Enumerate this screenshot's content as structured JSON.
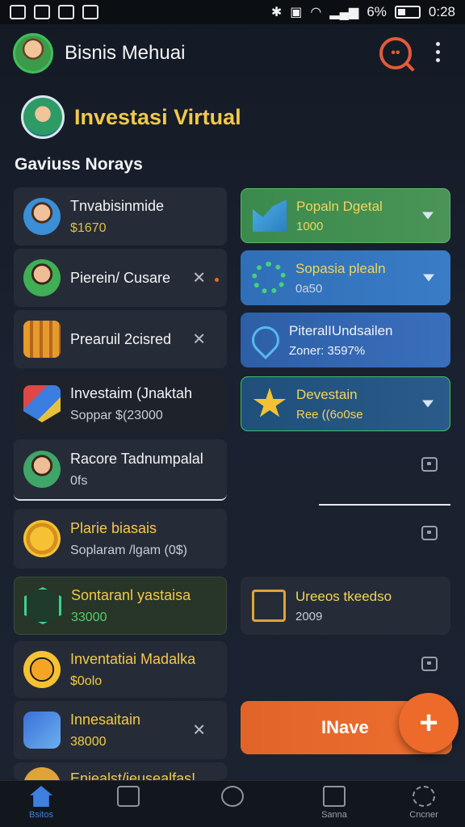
{
  "status_bar": {
    "battery_text": "6%",
    "time": "0:28"
  },
  "header": {
    "title": "Bisnis Mehuai"
  },
  "banner": {
    "title": "Investasi Virtual"
  },
  "section": {
    "title": "Gaviuss Norays"
  },
  "left_cards": [
    {
      "name": "Tnvabisinmide",
      "sub": "$1670"
    },
    {
      "name": "Pierein/ Cusare",
      "sub": ""
    },
    {
      "name": "Prearuil 2cisred",
      "sub": ""
    },
    {
      "name": "Investaim (Jnaktah",
      "sub": "Soppar $(23000"
    },
    {
      "name": "Racore Tadnumpalal",
      "sub": "0fs"
    },
    {
      "name": "Plarie biasais",
      "sub": "Soplaram /lgam (0$)"
    },
    {
      "name": "Sontaranl yastaisa",
      "sub": "33000"
    },
    {
      "name": "Inventatiai Madalka",
      "sub": "$0olo"
    },
    {
      "name": "Innesaitain",
      "sub": "38000"
    },
    {
      "name": "Eniealst/jeusealfas!",
      "sub": ""
    }
  ],
  "right_cards": [
    {
      "name": "Popaln Dgetal",
      "sub": "1000"
    },
    {
      "name": "Sopasia plealn",
      "sub": "0a50"
    },
    {
      "name": "PiteralIUndsailen",
      "sub": "Zoner: 3597%"
    },
    {
      "name": "Devestain",
      "sub": "Ree ((6o0se"
    },
    {
      "name": "Ureeos tkeedso",
      "sub": "2009"
    }
  ],
  "cta": {
    "label": "INave"
  },
  "fab": {
    "label": "+"
  },
  "nav": [
    {
      "label": "Bsitos"
    },
    {
      "label": ""
    },
    {
      "label": ""
    },
    {
      "label": "Sanna"
    },
    {
      "label": "Cncner"
    }
  ],
  "colors": {
    "accent": "#ee6a2b",
    "banner_title": "#f3c94a",
    "nav_active": "#3f7fe0"
  }
}
